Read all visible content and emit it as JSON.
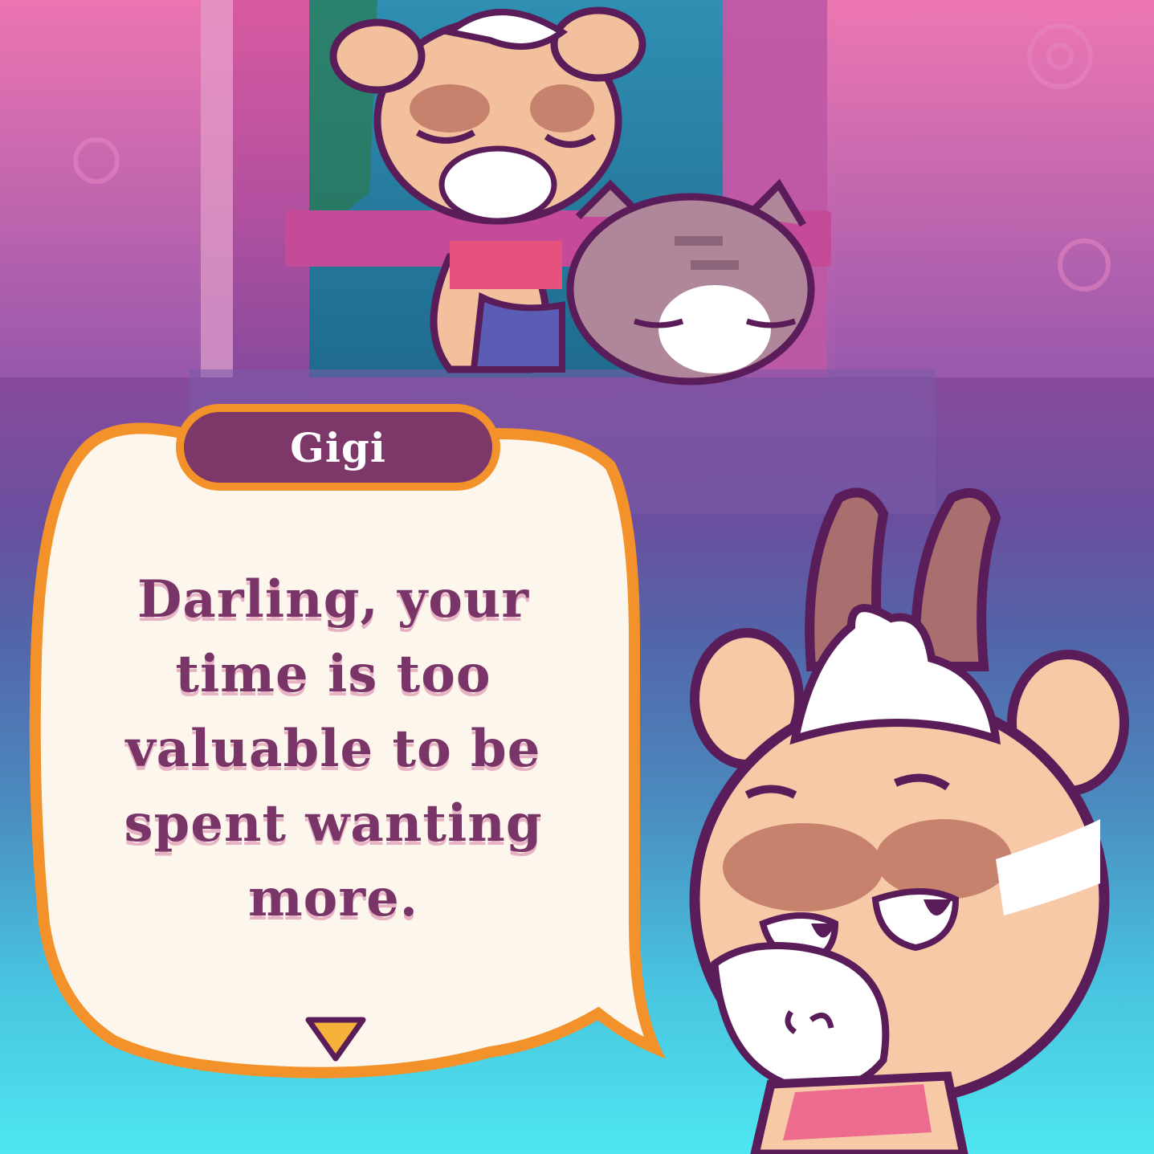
{
  "dialogue": {
    "speaker_name": "Gigi",
    "text": "Darling, your time is too valuable to be spent wanting more.",
    "advance_icon": "chevron-down-icon"
  },
  "colors": {
    "bubble_fill": "#fdf6ec",
    "bubble_border": "#f3922a",
    "name_tag": "#7d3768",
    "dialogue_text": "#7a3568",
    "text_shadow": "#e7b3c4",
    "advance_arrow": "#f7b23b",
    "outline": "#5a1d5a"
  }
}
